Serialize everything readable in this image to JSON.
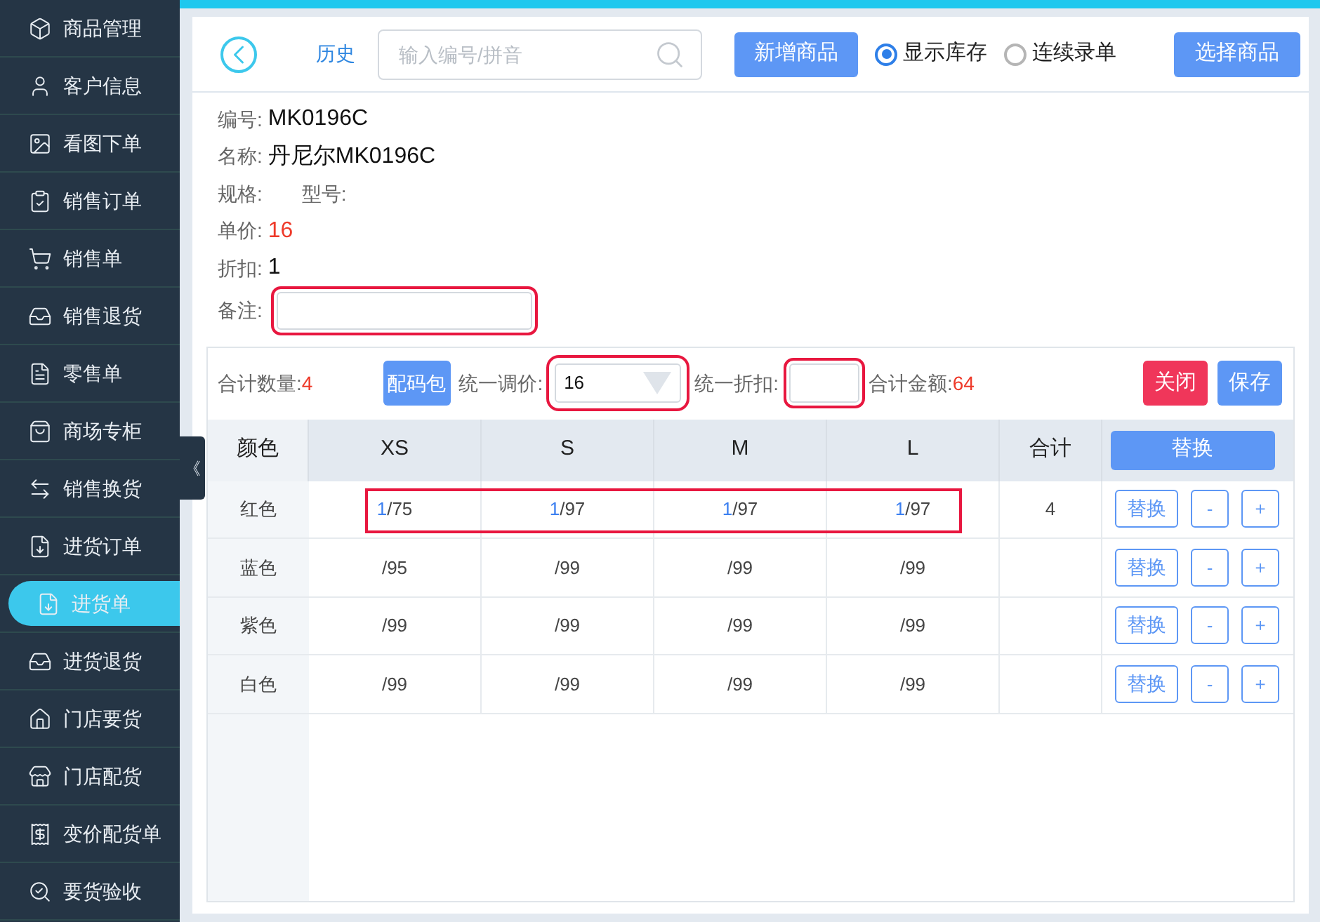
{
  "sidebar": {
    "items": [
      {
        "label": "商品管理",
        "selected": false
      },
      {
        "label": "客户信息",
        "selected": false
      },
      {
        "label": "看图下单",
        "selected": false
      },
      {
        "label": "销售订单",
        "selected": false
      },
      {
        "label": "销售单",
        "selected": false
      },
      {
        "label": "销售退货",
        "selected": false
      },
      {
        "label": "零售单",
        "selected": false
      },
      {
        "label": "商场专柜",
        "selected": false
      },
      {
        "label": "销售换货",
        "selected": false
      },
      {
        "label": "进货订单",
        "selected": false
      },
      {
        "label": "进货单",
        "selected": true
      },
      {
        "label": "进货退货",
        "selected": false
      },
      {
        "label": "门店要货",
        "selected": false
      },
      {
        "label": "门店配货",
        "selected": false
      },
      {
        "label": "变价配货单",
        "selected": false
      },
      {
        "label": "要货验收",
        "selected": false
      }
    ]
  },
  "collapse_toggle": "《",
  "header": {
    "history_link": "历史",
    "search": {
      "placeholder": "输入编号/拼音"
    },
    "add_button": "新增商品",
    "options": [
      {
        "label": "显示库存",
        "selected": true
      },
      {
        "label": "连续录单",
        "selected": false
      }
    ],
    "select_button": "选择商品"
  },
  "product": {
    "fields": [
      {
        "label": "编号:",
        "value": "MK0196C",
        "red": false
      },
      {
        "label": "名称:",
        "value": "丹尼尔MK0196C",
        "red": false
      },
      {
        "label": "规格:",
        "extra_label": "型号:"
      },
      {
        "label": "单价:",
        "value": "16",
        "red": true
      },
      {
        "label": "折扣:",
        "value": "1",
        "red": false
      }
    ],
    "note": {
      "label": "备注:",
      "highlighted": true
    }
  },
  "toolbar": {
    "total_qty_label": "合计数量:",
    "total_qty": "4",
    "size_pack_button": "配码包",
    "unified_price": {
      "label": "统一调价:",
      "value": "16",
      "highlighted": true
    },
    "unified_discount": {
      "label": "统一折扣:",
      "highlighted": true
    },
    "total_amount_label": "合计金额:",
    "total_amount": "64",
    "close_button": "关闭",
    "save_button": "保存"
  },
  "grid": {
    "first_header": "颜色",
    "size_headers": [
      "XS",
      "S",
      "M",
      "L"
    ],
    "total_header": "合计",
    "replace_all_button": "替换",
    "rows": [
      {
        "name": "红色",
        "highlighted": true,
        "sizes": [
          {
            "qty": "1",
            "stock": "/75"
          },
          {
            "qty": "1",
            "stock": "/97"
          },
          {
            "qty": "1",
            "stock": "/97"
          },
          {
            "qty": "1",
            "stock": "/97"
          }
        ],
        "total": "4",
        "actions": [
          "替换",
          "-",
          "+"
        ]
      },
      {
        "name": "蓝色",
        "highlighted": false,
        "sizes": [
          {
            "stock": "/95"
          },
          {
            "stock": "/99"
          },
          {
            "stock": "/99"
          },
          {
            "stock": "/99"
          }
        ],
        "actions": [
          "替换",
          "-",
          "+"
        ]
      },
      {
        "name": "紫色",
        "highlighted": false,
        "sizes": [
          {
            "stock": "/99"
          },
          {
            "stock": "/99"
          },
          {
            "stock": "/99"
          },
          {
            "stock": "/99"
          }
        ],
        "actions": [
          "替换",
          "-",
          "+"
        ]
      },
      {
        "name": "白色",
        "highlighted": false,
        "sizes": [
          {
            "stock": "/99"
          },
          {
            "stock": "/99"
          },
          {
            "stock": "/99"
          },
          {
            "stock": "/99"
          }
        ],
        "actions": [
          "替换",
          "-",
          "+"
        ]
      }
    ]
  }
}
